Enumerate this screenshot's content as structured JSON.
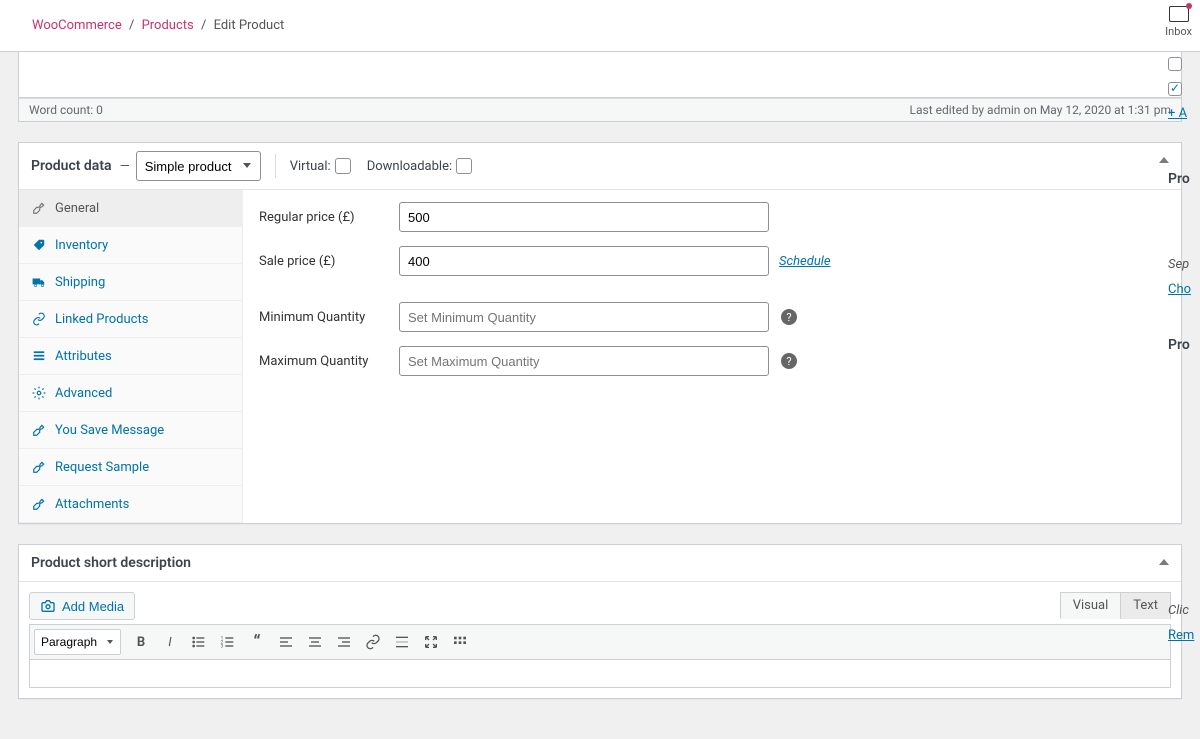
{
  "breadcrumb": {
    "woocommerce": "WooCommerce",
    "products": "Products",
    "current": "Edit Product"
  },
  "inbox_label": "Inbox",
  "word_count_label": "Word count: 0",
  "last_edited": "Last edited by admin on May 12, 2020 at 1:31 pm",
  "product_data": {
    "title": "Product data",
    "type_selected": "Simple product",
    "virtual_label": "Virtual:",
    "downloadable_label": "Downloadable:"
  },
  "tabs": {
    "general": "General",
    "inventory": "Inventory",
    "shipping": "Shipping",
    "linked": "Linked Products",
    "attributes": "Attributes",
    "advanced": "Advanced",
    "yousave": "You Save Message",
    "requestsample": "Request Sample",
    "attachments": "Attachments"
  },
  "fields": {
    "regular_price_label": "Regular price (£)",
    "regular_price_value": "500",
    "sale_price_label": "Sale price (£)",
    "sale_price_value": "400",
    "schedule": "Schedule",
    "min_qty_label": "Minimum Quantity",
    "min_qty_placeholder": "Set Minimum Quantity",
    "max_qty_label": "Maximum Quantity",
    "max_qty_placeholder": "Set Maximum Quantity"
  },
  "short_desc_title": "Product short description",
  "add_media": "Add Media",
  "editor_tabs": {
    "visual": "Visual",
    "text": "Text"
  },
  "format_selected": "Paragraph",
  "side": {
    "add_link": "+ A",
    "pro1": "Pro",
    "sep": "Sep",
    "cho": "Cho",
    "pro2": "Pro",
    "clic": "Clic",
    "rem": "Rem"
  }
}
